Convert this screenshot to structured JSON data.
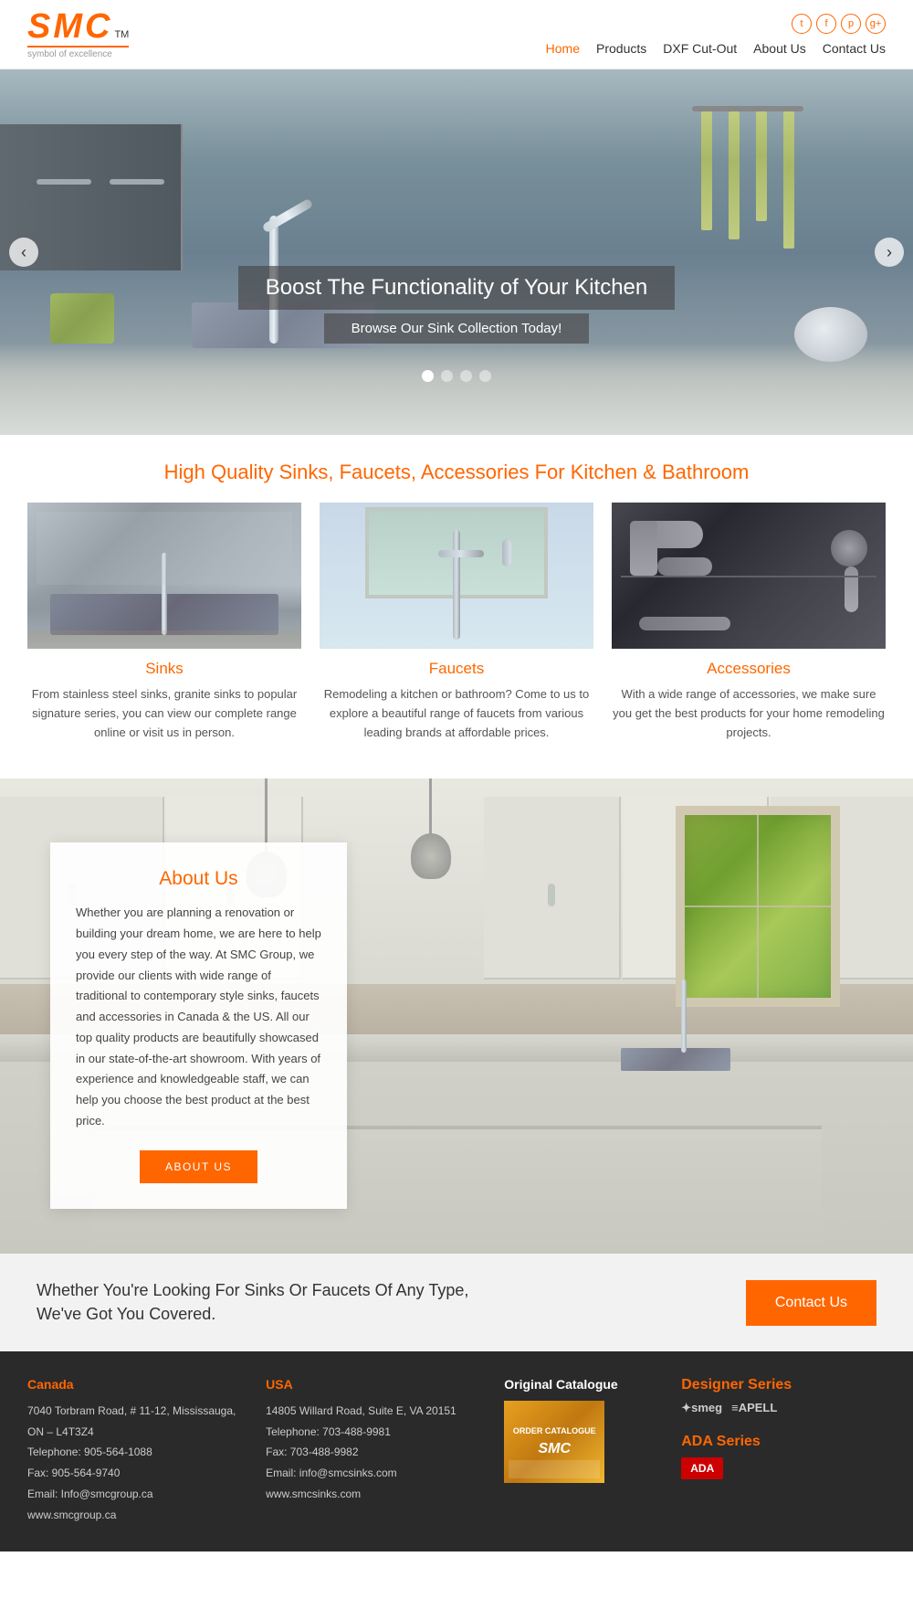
{
  "header": {
    "logo": "SMC",
    "logo_italic": "TM",
    "tagline": "symbol of excellence",
    "social": [
      "t",
      "f",
      "p",
      "g+"
    ],
    "nav": [
      {
        "label": "Home",
        "active": true
      },
      {
        "label": "Products",
        "active": false
      },
      {
        "label": "DXF Cut-Out",
        "active": false
      },
      {
        "label": "About Us",
        "active": false
      },
      {
        "label": "Contact Us",
        "active": false
      }
    ]
  },
  "hero": {
    "title": "Boost The Functionality of Your Kitchen",
    "subtitle": "Browse Our Sink Collection Today!",
    "dots": [
      true,
      false,
      false,
      false
    ],
    "arrow_left": "‹",
    "arrow_right": "›"
  },
  "products": {
    "section_title": "High Quality Sinks, Faucets, Accessories For Kitchen & Bathroom",
    "items": [
      {
        "name": "Sinks",
        "description": "From stainless steel sinks, granite sinks to popular signature series, you can view our complete range online or visit us in person."
      },
      {
        "name": "Faucets",
        "description": "Remodeling a kitchen or bathroom? Come to us to explore a beautiful range of faucets from various leading brands at affordable prices."
      },
      {
        "name": "Accessories",
        "description": "With a wide range of accessories, we make sure you get the best products for your home remodeling projects."
      }
    ]
  },
  "about": {
    "section_title": "About Us",
    "text": "Whether you are planning a renovation or building your dream home, we are here to help you every step of the way. At SMC Group, we provide our clients with wide range of traditional to contemporary style sinks, faucets and accessories in Canada & the US. All our top quality products are beautifully showcased in our state-of-the-art showroom. With years of experience and knowledgeable staff, we can help you choose the best product at the best price.",
    "button": "ABOUT US"
  },
  "cta": {
    "text": "Whether You're Looking For Sinks Or Faucets Of Any Type, We've Got You Covered.",
    "button": "Contact Us"
  },
  "footer": {
    "canada": {
      "title": "Canada",
      "address": "7040 Torbram Road, # 11-12, Mississauga, ON – L4T3Z4",
      "phone": "Telephone: 905-564-1088",
      "fax": "Fax: 905-564-9740",
      "email": "Email: Info@smcgroup.ca",
      "website": "www.smcgroup.ca"
    },
    "usa": {
      "title": "USA",
      "address": "14805 Willard Road, Suite E, VA 20151",
      "phone": "Telephone: 703-488-9981",
      "fax": "Fax: 703-488-9982",
      "email": "Email: info@smcsinks.com",
      "website": "www.smcsinks.com"
    },
    "catalogue": {
      "title": "Original Catalogue",
      "label": "ORDER CATALOGUE\nSMC"
    },
    "designer": {
      "title": "Designer Series",
      "brands": [
        "✦smeg",
        "≡APELL"
      ]
    },
    "ada": {
      "title": "ADA Series",
      "badge": "ADA"
    }
  }
}
